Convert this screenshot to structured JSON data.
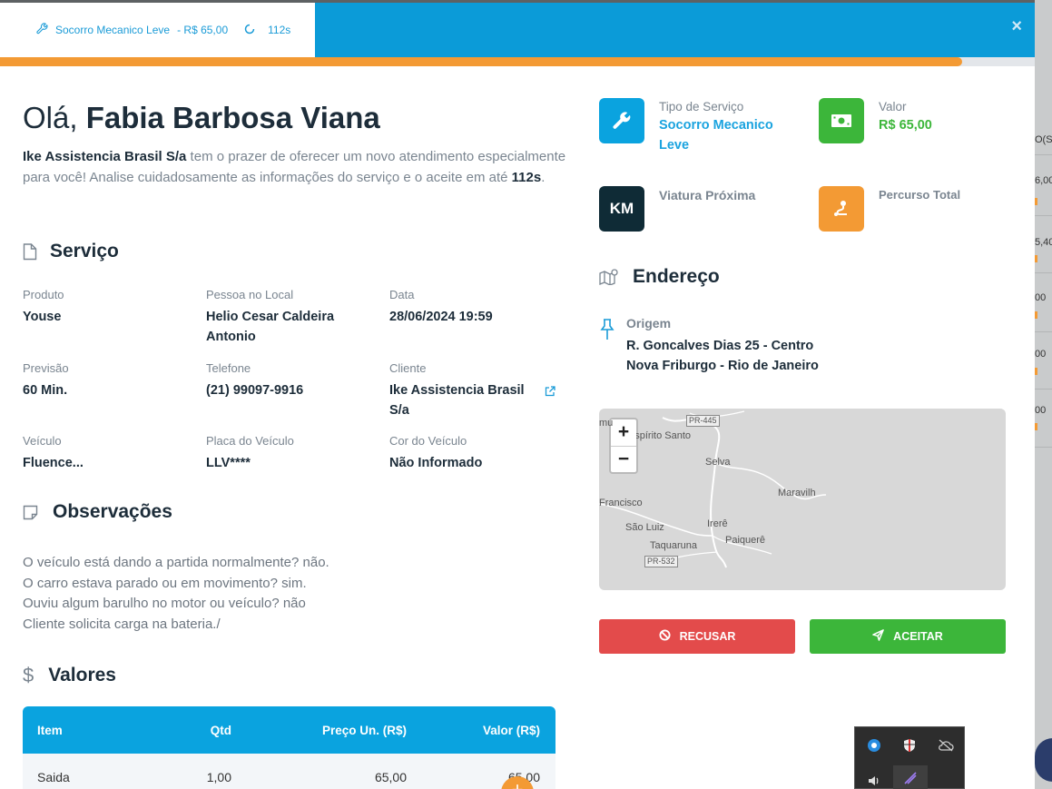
{
  "topbar": {
    "service": "Socorro Mecanico Leve",
    "price": "- R$ 65,00",
    "timer": "112s",
    "close": "×"
  },
  "progress": {
    "fraction": 0.93
  },
  "greeting": {
    "hello": "Olá,",
    "name": "Fabia Barbosa Viana"
  },
  "intro": {
    "company": "Ike Assistencia Brasil S/a",
    "text1": " tem o prazer de oferecer um novo atendimento especialmente para você! Analise cuidadosamente as informações do serviço e o aceite em até ",
    "deadline": "112s",
    "text2": "."
  },
  "servico": {
    "title": "Serviço",
    "fields": [
      {
        "label": "Produto",
        "value": "Youse"
      },
      {
        "label": "Pessoa no Local",
        "value": "Helio Cesar Caldeira Antonio"
      },
      {
        "label": "Data",
        "value": "28/06/2024 19:59"
      },
      {
        "label": "Previsão",
        "value": "60 Min."
      },
      {
        "label": "Telefone",
        "value": "(21) 99097-9916"
      },
      {
        "label": "Cliente",
        "value": "Ike Assistencia Brasil S/a"
      },
      {
        "label": "Veículo",
        "value": "Fluence..."
      },
      {
        "label": "Placa do Veículo",
        "value": "LLV****"
      },
      {
        "label": "Cor do Veículo",
        "value": "Não Informado"
      }
    ]
  },
  "observacoes": {
    "title": "Observações",
    "lines": [
      "O veículo está dando a partida normalmente? não.",
      "O carro estava parado ou em movimento? sim.",
      "Ouviu algum barulho no motor ou veículo? não",
      "Cliente solicita carga na bateria./"
    ]
  },
  "valores": {
    "title": "Valores",
    "headers": [
      "Item",
      "Qtd",
      "Preço Un. (R$)",
      "Valor (R$)"
    ],
    "rows": [
      [
        "Saida",
        "1,00",
        "65,00",
        "65,00"
      ]
    ],
    "fab": "+"
  },
  "cards": {
    "tipo": {
      "label": "Tipo de Serviço",
      "value": "Socorro Mecanico Leve"
    },
    "valor": {
      "label": "Valor",
      "value": "R$ 65,00"
    },
    "viatura": {
      "label": "Viatura Próxima",
      "badge": "KM"
    },
    "percurso": {
      "label": "Percurso Total"
    }
  },
  "endereco": {
    "title": "Endereço",
    "origin_label": "Origem",
    "line1": "R. Goncalves Dias 25 - Centro",
    "line2": "Nova Friburgo - Rio de Janeiro"
  },
  "map": {
    "zoom_in": "+",
    "zoom_out": "−",
    "labels": [
      "Espírito Santo",
      "Selva",
      "Maravilh",
      "Francisco",
      "São Luiz",
      "Irerê",
      "Taquaruna",
      "Paiquerê"
    ],
    "roads": [
      "PR-445",
      "PR-532"
    ],
    "edge": "mu"
  },
  "buttons": {
    "refuse": "RECUSAR",
    "accept": "ACEITAR"
  },
  "background": {
    "cells": [
      "O(S",
      "6,00",
      "5,40",
      "00",
      "00",
      "00"
    ]
  },
  "colors": {
    "blue": "#0b9bd8",
    "orange": "#f39a34",
    "green": "#3cb63a",
    "red": "#e34b4b",
    "dark": "#0f2b36"
  }
}
